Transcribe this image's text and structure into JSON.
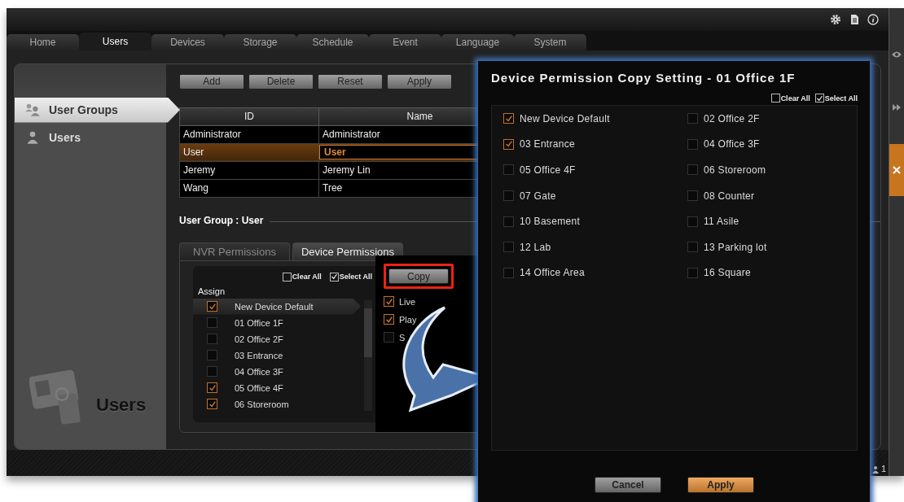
{
  "tabs": [
    {
      "label": "Home",
      "selected": false
    },
    {
      "label": "Users",
      "selected": true
    },
    {
      "label": "Devices",
      "selected": false
    },
    {
      "label": "Storage",
      "selected": false
    },
    {
      "label": "Schedule",
      "selected": false
    },
    {
      "label": "Event",
      "selected": false
    },
    {
      "label": "Language",
      "selected": false
    },
    {
      "label": "System",
      "selected": false
    }
  ],
  "sidebar": {
    "items": [
      {
        "label": "User Groups",
        "kind": "group",
        "selected": true
      },
      {
        "label": "Users",
        "kind": "user",
        "selected": false
      }
    ],
    "logo_text": "Users"
  },
  "toolbar": {
    "buttons": [
      "Add",
      "Delete",
      "Reset",
      "Apply"
    ]
  },
  "table": {
    "columns": [
      "ID",
      "Name"
    ],
    "rows": [
      {
        "cells": [
          "Administrator",
          "Administrator"
        ],
        "selected": false
      },
      {
        "cells": [
          "User",
          "User"
        ],
        "selected": true
      },
      {
        "cells": [
          "Jeremy",
          "Jeremy Lin"
        ],
        "selected": false
      },
      {
        "cells": [
          "Wang",
          "Tree"
        ],
        "selected": false
      }
    ]
  },
  "group_heading": "User Group : User",
  "permission_tabs": [
    {
      "label": "NVR Permissions",
      "selected": false
    },
    {
      "label": "Device Permissions",
      "selected": true
    }
  ],
  "device_list": {
    "clear_all": {
      "label": "Clear All",
      "checked": false
    },
    "select_all": {
      "label": "Select All",
      "checked": true
    },
    "header": "Assign",
    "items": [
      {
        "label": "New Device Default",
        "checked": true,
        "selected": true
      },
      {
        "label": "01 Office 1F",
        "checked": false,
        "selected": false
      },
      {
        "label": "02 Office 2F",
        "checked": false,
        "selected": false
      },
      {
        "label": "03 Entrance",
        "checked": false,
        "selected": false
      },
      {
        "label": "04 Office 3F",
        "checked": false,
        "selected": false
      },
      {
        "label": "05 Office 4F",
        "checked": true,
        "selected": false
      },
      {
        "label": "06 Storeroom",
        "checked": true,
        "selected": false
      }
    ]
  },
  "copy_button": "Copy",
  "permissions": [
    {
      "label": "Live",
      "checked": true
    },
    {
      "label": "Play",
      "checked": true
    },
    {
      "label": "S",
      "checked": false
    }
  ],
  "status_bar": {
    "user_count": "1"
  },
  "dialog": {
    "title": "Device Permission Copy Setting - 01 Office 1F",
    "clear_all": {
      "label": "Clear All",
      "checked": false
    },
    "select_all": {
      "label": "Select All",
      "checked": true
    },
    "devices": [
      {
        "label": "New Device Default",
        "checked": true
      },
      {
        "label": "02 Office 2F",
        "checked": false
      },
      {
        "label": "03 Entrance",
        "checked": true
      },
      {
        "label": "04 Office 3F",
        "checked": false
      },
      {
        "label": "05 Office 4F",
        "checked": false
      },
      {
        "label": "06 Storeroom",
        "checked": false
      },
      {
        "label": "07 Gate",
        "checked": false
      },
      {
        "label": "08 Counter",
        "checked": false
      },
      {
        "label": "10 Basement",
        "checked": false
      },
      {
        "label": "11 Asile",
        "checked": false
      },
      {
        "label": "12 Lab",
        "checked": false
      },
      {
        "label": "13 Parking lot",
        "checked": false
      },
      {
        "label": "14 Office Area",
        "checked": false
      },
      {
        "label": "16 Square",
        "checked": false
      }
    ],
    "buttons": [
      {
        "label": "Cancel",
        "kind": "secondary"
      },
      {
        "label": "Apply",
        "kind": "primary"
      }
    ]
  }
}
